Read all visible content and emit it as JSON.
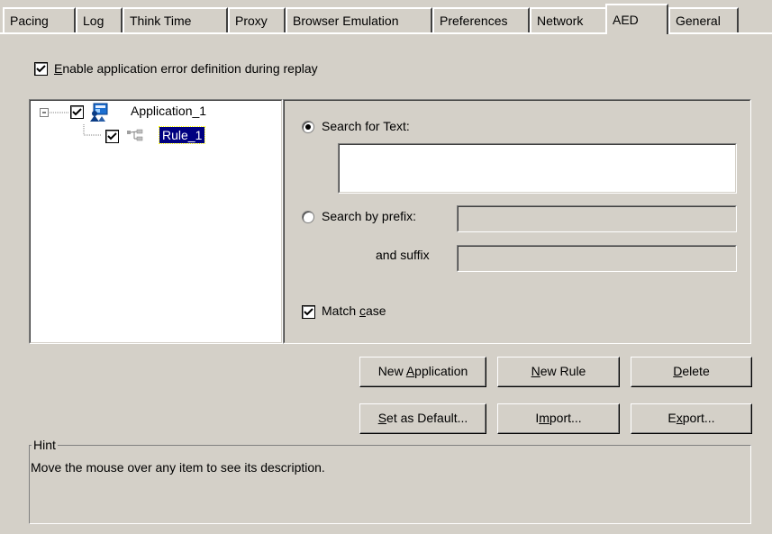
{
  "tabs": [
    {
      "label": "Pacing"
    },
    {
      "label": "Log"
    },
    {
      "label": "Think Time"
    },
    {
      "label": "Proxy"
    },
    {
      "label": "Browser Emulation"
    },
    {
      "label": "Preferences"
    },
    {
      "label": "Network"
    },
    {
      "label": "AED",
      "active": true
    },
    {
      "label": "General"
    }
  ],
  "enable_aed": {
    "pre": "",
    "underline": "E",
    "post": "nable application error definition during replay",
    "checked": true
  },
  "tree": {
    "application": {
      "label": "Application_1",
      "checked": true,
      "icon": "application-icon"
    },
    "rule": {
      "label": "Rule_1",
      "checked": true,
      "selected": true,
      "icon": "rule-icon"
    }
  },
  "search_text": {
    "label": "Search for Text:",
    "selected": true,
    "value": ""
  },
  "search_prefix": {
    "label": "Search by prefix:",
    "selected": false,
    "value": ""
  },
  "suffix": {
    "label": "and suffix",
    "value": ""
  },
  "match_case": {
    "pre": "Match ",
    "underline": "c",
    "post": "ase",
    "checked": true
  },
  "buttons": {
    "new_application": {
      "pre": "New ",
      "underline": "A",
      "post": "pplication"
    },
    "new_rule": {
      "pre": "",
      "underline": "N",
      "post": "ew Rule"
    },
    "delete": {
      "pre": "",
      "underline": "D",
      "post": "elete"
    },
    "set_default": {
      "pre": "",
      "underline": "S",
      "post": "et as Default..."
    },
    "import": {
      "pre": "I",
      "underline": "m",
      "post": "port..."
    },
    "export": {
      "pre": "E",
      "underline": "x",
      "post": "port..."
    }
  },
  "hint": {
    "title": "Hint",
    "text": "Move the mouse over any item to see its description."
  }
}
